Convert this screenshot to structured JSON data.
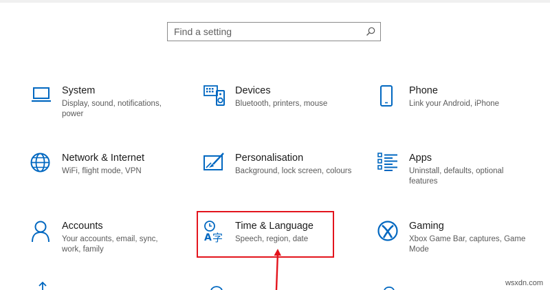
{
  "search": {
    "placeholder": "Find a setting",
    "icon": "search-icon"
  },
  "accent_color": "#0067c0",
  "highlight_color": "#e3131c",
  "tiles": [
    {
      "title": "System",
      "desc": "Display, sound, notifications, power",
      "icon": "laptop-icon"
    },
    {
      "title": "Devices",
      "desc": "Bluetooth, printers, mouse",
      "icon": "keyboard-speaker-icon"
    },
    {
      "title": "Phone",
      "desc": "Link your Android, iPhone",
      "icon": "phone-icon"
    },
    {
      "title": "Network & Internet",
      "desc": "WiFi, flight mode, VPN",
      "icon": "globe-icon"
    },
    {
      "title": "Personalisation",
      "desc": "Background, lock screen, colours",
      "icon": "paint-brush-icon"
    },
    {
      "title": "Apps",
      "desc": "Uninstall, defaults, optional features",
      "icon": "apps-list-icon"
    },
    {
      "title": "Accounts",
      "desc": "Your accounts, email, sync, work, family",
      "icon": "person-icon"
    },
    {
      "title": "Time & Language",
      "desc": "Speech, region, date",
      "icon": "time-language-icon"
    },
    {
      "title": "Gaming",
      "desc": "Xbox Game Bar, captures, Game Mode",
      "icon": "xbox-icon"
    }
  ],
  "watermark": "wsxdn.com"
}
